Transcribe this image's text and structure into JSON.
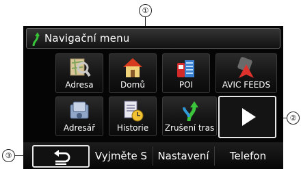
{
  "callouts": {
    "one": "①",
    "two": "②",
    "three": "③"
  },
  "header": {
    "title": "Navigační menu"
  },
  "tiles": [
    {
      "label": "Adresa",
      "icon": "map-magnifier-icon"
    },
    {
      "label": "Domů",
      "icon": "home-icon"
    },
    {
      "label": "POI",
      "icon": "poi-icon"
    },
    {
      "label": "AVIC FEEDS",
      "icon": "avic-feeds-icon"
    },
    {
      "label": "Adresář",
      "icon": "address-book-icon"
    },
    {
      "label": "Historie",
      "icon": "history-icon"
    },
    {
      "label": "Zrušení tras",
      "icon": "cancel-route-icon"
    }
  ],
  "next_button": {
    "icon": "play-arrow-icon"
  },
  "bottom": {
    "back_icon": "back-arrow-icon",
    "items": [
      "Vyjměte S",
      "Nastavení",
      "Telefon"
    ]
  },
  "colors": {
    "background": "#050505",
    "text": "#ffffff",
    "highlight_border": "#e8e8e8"
  }
}
